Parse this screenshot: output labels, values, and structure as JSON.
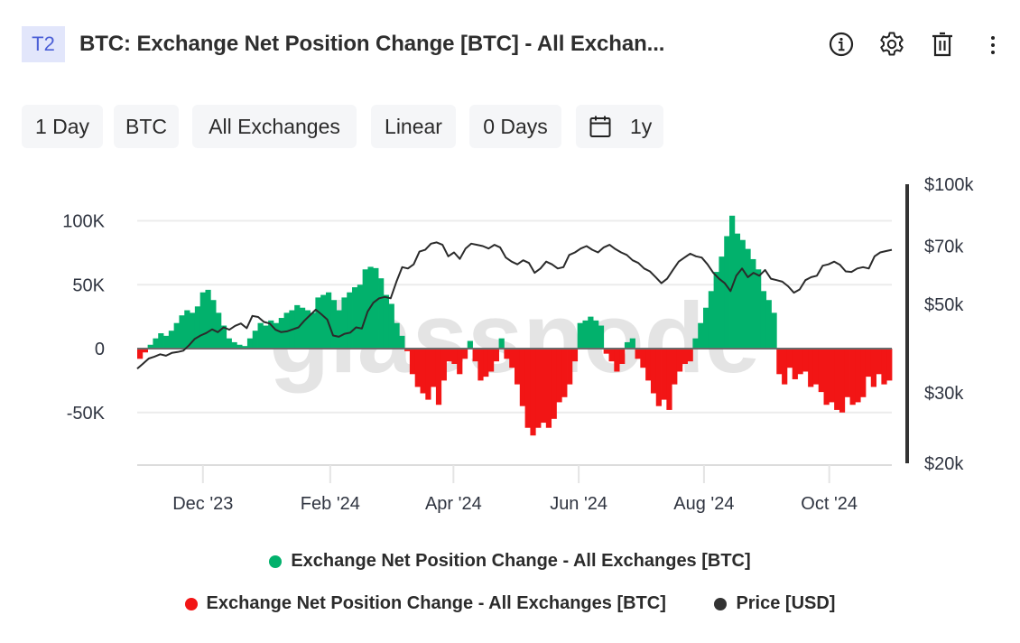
{
  "header": {
    "badge": "T2",
    "title": "BTC: Exchange Net Position Change [BTC] - All Exchan...",
    "icons": [
      "info-icon",
      "gear-icon",
      "trash-icon",
      "more-vertical-icon"
    ]
  },
  "toolbar": {
    "resolution": "1 Day",
    "asset": "BTC",
    "exchange": "All Exchanges",
    "scale": "Linear",
    "smoothing": "0 Days",
    "range": "1y",
    "range_icon": "calendar-icon"
  },
  "watermark": "glassnode",
  "colors": {
    "positive": "#02b16c",
    "negative": "#f21515",
    "price": "#2b2b2b",
    "zero_line": "#6b6b6b",
    "grid": "#ececec",
    "badge_bg": "#e2e6fb",
    "badge_text": "#4b5fd6"
  },
  "legend": [
    {
      "label": "Exchange Net Position Change - All Exchanges [BTC]",
      "color": "#02b16c"
    },
    {
      "label": "Exchange Net Position Change - All Exchanges [BTC]",
      "color": "#f21515"
    },
    {
      "label": "Price [USD]",
      "color": "#333333"
    }
  ],
  "chart_data": {
    "type": "bar",
    "title": "BTC: Exchange Net Position Change [BTC] - All Exchanges",
    "x_start": "2023-10-30",
    "x_step_days": 3,
    "x_ticks": [
      {
        "label": "Dec '23",
        "date": "2023-12-01"
      },
      {
        "label": "Feb '24",
        "date": "2024-02-01"
      },
      {
        "label": "Apr '24",
        "date": "2024-04-01"
      },
      {
        "label": "Jun '24",
        "date": "2024-06-01"
      },
      {
        "label": "Aug '24",
        "date": "2024-08-01"
      },
      {
        "label": "Oct '24",
        "date": "2024-10-01"
      }
    ],
    "y_left": {
      "label": "Exchange Net Position Change [BTC]",
      "ticks": [
        {
          "value": 100000,
          "label": "100K"
        },
        {
          "value": 50000,
          "label": "50K"
        },
        {
          "value": 0,
          "label": "0"
        },
        {
          "value": -50000,
          "label": "-50K"
        }
      ],
      "ylim": [
        -90000,
        100000
      ]
    },
    "y_right": {
      "label": "Price [USD]",
      "scale": "log",
      "ticks": [
        {
          "value": 100000,
          "label": "$100k"
        },
        {
          "value": 70000,
          "label": "$70k"
        },
        {
          "value": 50000,
          "label": "$50k"
        },
        {
          "value": 30000,
          "label": "$30k"
        },
        {
          "value": 20000,
          "label": "$20k"
        }
      ],
      "ylim": [
        20000,
        100000
      ]
    },
    "grid": true,
    "legend_position": "bottom",
    "series": [
      {
        "name": "Exchange Net Position Change - All Exchanges [BTC]",
        "unit": "thousand BTC",
        "values": [
          -8,
          -3,
          3,
          8,
          12,
          10,
          14,
          20,
          26,
          30,
          28,
          33,
          44,
          46,
          38,
          28,
          18,
          8,
          5,
          3,
          2,
          8,
          14,
          20,
          18,
          22,
          20,
          24,
          28,
          30,
          34,
          32,
          30,
          28,
          40,
          42,
          44,
          38,
          30,
          40,
          44,
          48,
          50,
          62,
          64,
          63,
          55,
          42,
          35,
          20,
          10,
          -2,
          -20,
          -30,
          -35,
          -40,
          -30,
          -44,
          -25,
          -10,
          -12,
          -20,
          -8,
          6,
          -10,
          -25,
          -22,
          -18,
          -10,
          8,
          -8,
          -15,
          -28,
          -45,
          -62,
          -68,
          -62,
          -58,
          -62,
          -55,
          -42,
          -38,
          -28,
          -10,
          20,
          22,
          25,
          22,
          18,
          -4,
          -10,
          -18,
          -12,
          5,
          8,
          -8,
          -15,
          -25,
          -35,
          -45,
          -40,
          -48,
          -28,
          -18,
          -12,
          -10,
          8,
          20,
          32,
          45,
          60,
          72,
          88,
          104,
          90,
          85,
          78,
          70,
          62,
          45,
          38,
          28,
          -20,
          -28,
          -15,
          -24,
          -20,
          -18,
          -30,
          -28,
          -34,
          -44,
          -42,
          -48,
          -50,
          -38,
          -44,
          -42,
          -38,
          -22,
          -30,
          -20,
          -28,
          -25
        ],
        "colors": {
          "positive": "#02b16c",
          "negative": "#f21515"
        }
      },
      {
        "name": "Price [USD]",
        "unit": "thousand USD",
        "values": [
          34.5,
          35.5,
          36.6,
          37.0,
          37.5,
          37.2,
          37.8,
          38.0,
          38.3,
          39.5,
          41.0,
          41.8,
          42.4,
          43.3,
          42.6,
          43.8,
          43.2,
          44.2,
          44.8,
          43.6,
          46.8,
          46.5,
          45.2,
          44.8,
          43.2,
          42.6,
          42.8,
          43.3,
          43.8,
          45.5,
          47.0,
          48.5,
          47.2,
          45.8,
          41.8,
          41.5,
          42.2,
          42.5,
          43.8,
          43.5,
          48.0,
          50.5,
          51.8,
          52.2,
          51.8,
          57.0,
          62.0,
          61.5,
          63.0,
          67.8,
          68.5,
          71.0,
          71.5,
          70.5,
          66.0,
          67.5,
          65.0,
          69.0,
          71.0,
          70.5,
          70.0,
          69.0,
          70.5,
          69.5,
          65.5,
          64.0,
          63.0,
          64.5,
          63.5,
          60.0,
          61.5,
          64.0,
          63.0,
          61.5,
          62.0,
          66.5,
          67.5,
          69.0,
          70.0,
          68.5,
          67.5,
          69.5,
          70.5,
          68.8,
          67.5,
          66.5,
          64.5,
          63.5,
          61.5,
          60.5,
          58.5,
          56.5,
          58.0,
          61.0,
          64.0,
          65.5,
          67.0,
          66.0,
          65.5,
          63.0,
          60.0,
          58.0,
          56.5,
          54.0,
          59.0,
          61.5,
          58.5,
          60.0,
          59.0,
          61.0,
          58.0,
          57.5,
          57.0,
          55.5,
          53.5,
          54.5,
          57.5,
          58.5,
          59.0,
          62.5,
          63.0,
          64.0,
          62.8,
          60.5,
          60.3,
          61.5,
          62.0,
          61.5,
          66.0,
          67.5,
          68.0,
          68.5
        ],
        "color": "#2b2b2b"
      }
    ]
  }
}
